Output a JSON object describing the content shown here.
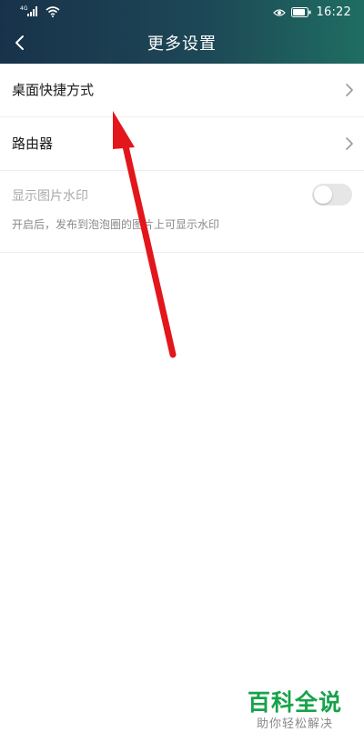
{
  "status_bar": {
    "signal_label": "4G",
    "time": "16:22"
  },
  "header": {
    "title": "更多设置"
  },
  "settings": {
    "items": [
      {
        "label": "桌面快捷方式"
      },
      {
        "label": "路由器"
      }
    ],
    "watermark_toggle": {
      "label": "显示图片水印",
      "description": "开启后，发布到泡泡圈的图片上可显示水印",
      "enabled": false
    }
  },
  "watermark": {
    "title": "百科全说",
    "subtitle": "助你轻松解决"
  },
  "colors": {
    "header_start": "#18324a",
    "header_end": "#1f6d62",
    "annotation_arrow": "#e3161b",
    "watermark_green": "#16a34a"
  }
}
